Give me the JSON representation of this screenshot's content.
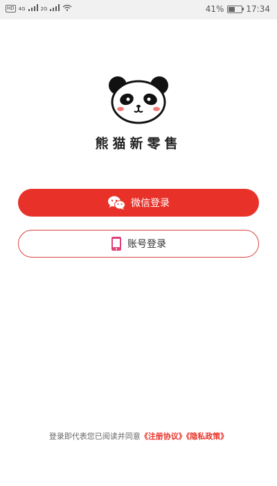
{
  "status_bar": {
    "hd_label": "HD",
    "net_label_1": "4G",
    "net_label_2": "2G",
    "battery_text": "41%",
    "battery_level": 0.41,
    "time": "17:34"
  },
  "app": {
    "name": "熊猫新零售",
    "logo_icon": "panda-icon"
  },
  "buttons": {
    "wechat_label": "微信登录",
    "wechat_icon": "wechat-icon",
    "account_label": "账号登录",
    "account_icon": "phone-icon"
  },
  "terms": {
    "prefix": "登录即代表您已阅读并同意",
    "user_agreement": "《注册协议》",
    "privacy_policy": "《隐私政策》"
  },
  "colors": {
    "primary": "#e83229",
    "accent_pink": "#e0407a"
  }
}
